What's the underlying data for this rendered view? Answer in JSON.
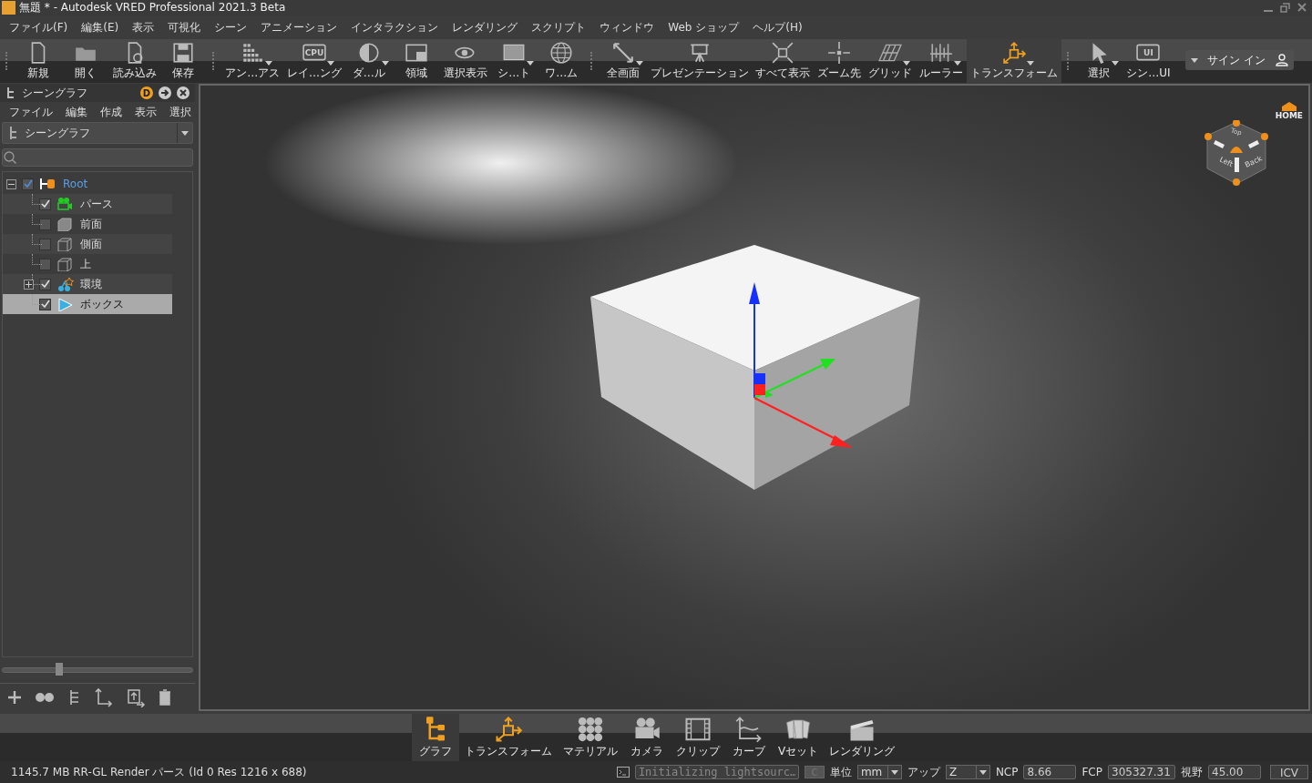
{
  "window": {
    "title": "無題 * - Autodesk VRED Professional 2021.3 Beta"
  },
  "menu": [
    "ファイル(F)",
    "編集(E)",
    "表示",
    "可視化",
    "シーン",
    "アニメーション",
    "インタラクション",
    "レンダリング",
    "スクリプト",
    "ウィンドウ",
    "Web ショップ",
    "ヘルプ(H)"
  ],
  "toolbar_groups": [
    [
      {
        "label": "新規",
        "dropdown": false,
        "active": false
      },
      {
        "label": "開く",
        "dropdown": false,
        "active": false
      },
      {
        "label": "読み込み",
        "dropdown": false,
        "active": false
      },
      {
        "label": "保存",
        "dropdown": false,
        "active": false
      }
    ],
    [
      {
        "label": "アン…アス",
        "dropdown": true,
        "active": false
      },
      {
        "label": "レイ…ング",
        "icon_text": "CPU",
        "dropdown": true,
        "active": false
      },
      {
        "label": "ダ…ル",
        "dropdown": true,
        "active": false
      },
      {
        "label": "領域",
        "dropdown": false,
        "active": false
      },
      {
        "label": "選択表示",
        "dropdown": false,
        "active": false
      },
      {
        "label": "シ…ト",
        "dropdown": true,
        "active": false
      },
      {
        "label": "ワ…ム",
        "dropdown": false,
        "active": false
      }
    ],
    [
      {
        "label": "全画面",
        "dropdown": true,
        "active": false
      },
      {
        "label": "プレゼンテーション",
        "dropdown": false,
        "active": false
      },
      {
        "label": "すべて表示",
        "dropdown": false,
        "active": false
      },
      {
        "label": "ズーム先",
        "dropdown": false,
        "active": false
      },
      {
        "label": "グリッド",
        "dropdown": true,
        "active": false
      },
      {
        "label": "ルーラー",
        "dropdown": true,
        "active": false
      },
      {
        "label": "トランスフォーム",
        "dropdown": true,
        "active": true
      }
    ]
  ],
  "toolbar_right": [
    {
      "label": "選択",
      "dropdown": true,
      "active": false
    },
    {
      "label": "シン…UI",
      "icon_text": "UI",
      "dropdown": false,
      "active": false
    }
  ],
  "sign_in": "サイン イン",
  "scenegraph": {
    "title": "シーングラフ",
    "badge": "D",
    "menu": [
      "ファイル",
      "編集",
      "作成",
      "表示",
      "選択"
    ],
    "view": "シーングラフ",
    "tree": [
      {
        "label": "Root",
        "checked": true,
        "selected": false,
        "expanded": true,
        "children": [
          {
            "label": "パース",
            "checked": true,
            "selected": false
          },
          {
            "label": "前面",
            "checked": false,
            "selected": false
          },
          {
            "label": "側面",
            "checked": false,
            "selected": false
          },
          {
            "label": "上",
            "checked": false,
            "selected": false
          },
          {
            "label": "環境",
            "checked": true,
            "selected": false,
            "expanded": false
          },
          {
            "label": "ボックス",
            "checked": true,
            "selected": true
          }
        ]
      }
    ],
    "zoom_slider": {
      "level": 0.3
    }
  },
  "nav_cube": {
    "home": "HOME",
    "top": "Top",
    "left": "Left",
    "back": "Back"
  },
  "dock": [
    {
      "label": "グラフ",
      "selected": true
    },
    {
      "label": "トランスフォーム",
      "selected": false
    },
    {
      "label": "マテリアル",
      "selected": false
    },
    {
      "label": "カメラ",
      "selected": false
    },
    {
      "label": "クリップ",
      "selected": false
    },
    {
      "label": "カーブ",
      "selected": false
    },
    {
      "label": "Vセット",
      "selected": false
    },
    {
      "label": "レンダリング",
      "selected": false
    }
  ],
  "status": {
    "info": "1145.7 MB  RR-GL  Render パース (Id 0 Res 1216 x 688)",
    "log": "Initializing lightsourc…",
    "clear": "C",
    "unit_label": "単位",
    "unit": "mm",
    "up_label": "アップ",
    "up": "Z",
    "ncp_label": "NCP",
    "ncp": "8.66",
    "fcp_label": "FCP",
    "fcp": "305327.31",
    "fov_label": "視野",
    "fov": "45.00",
    "icv": "ICV"
  }
}
